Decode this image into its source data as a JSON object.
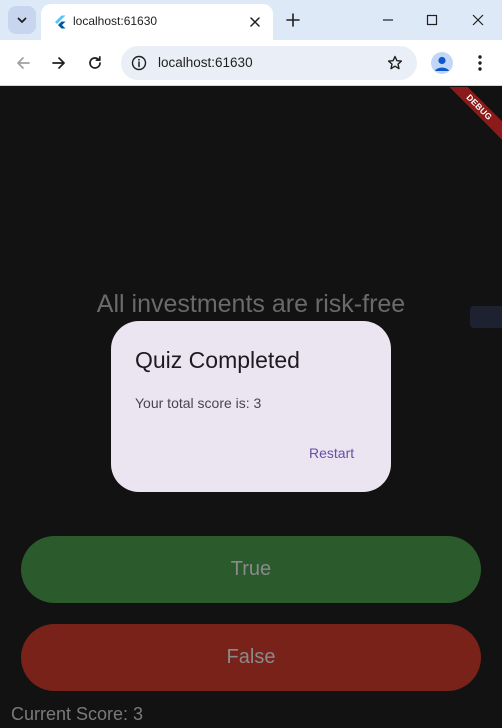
{
  "browser": {
    "tab_title": "localhost:61630",
    "url": "localhost:61630"
  },
  "app": {
    "debug_banner": "DEBUG",
    "question": "All investments are risk-free",
    "true_label": "True",
    "false_label": "False",
    "current_score": "Current Score: 3"
  },
  "dialog": {
    "title": "Quiz Completed",
    "body": "Your total score is: 3",
    "action_label": "Restart"
  },
  "colors": {
    "true_button": "#2b5a2d",
    "false_button": "#782219",
    "dialog_bg": "#ebe4f1",
    "accent": "#6750a4"
  }
}
